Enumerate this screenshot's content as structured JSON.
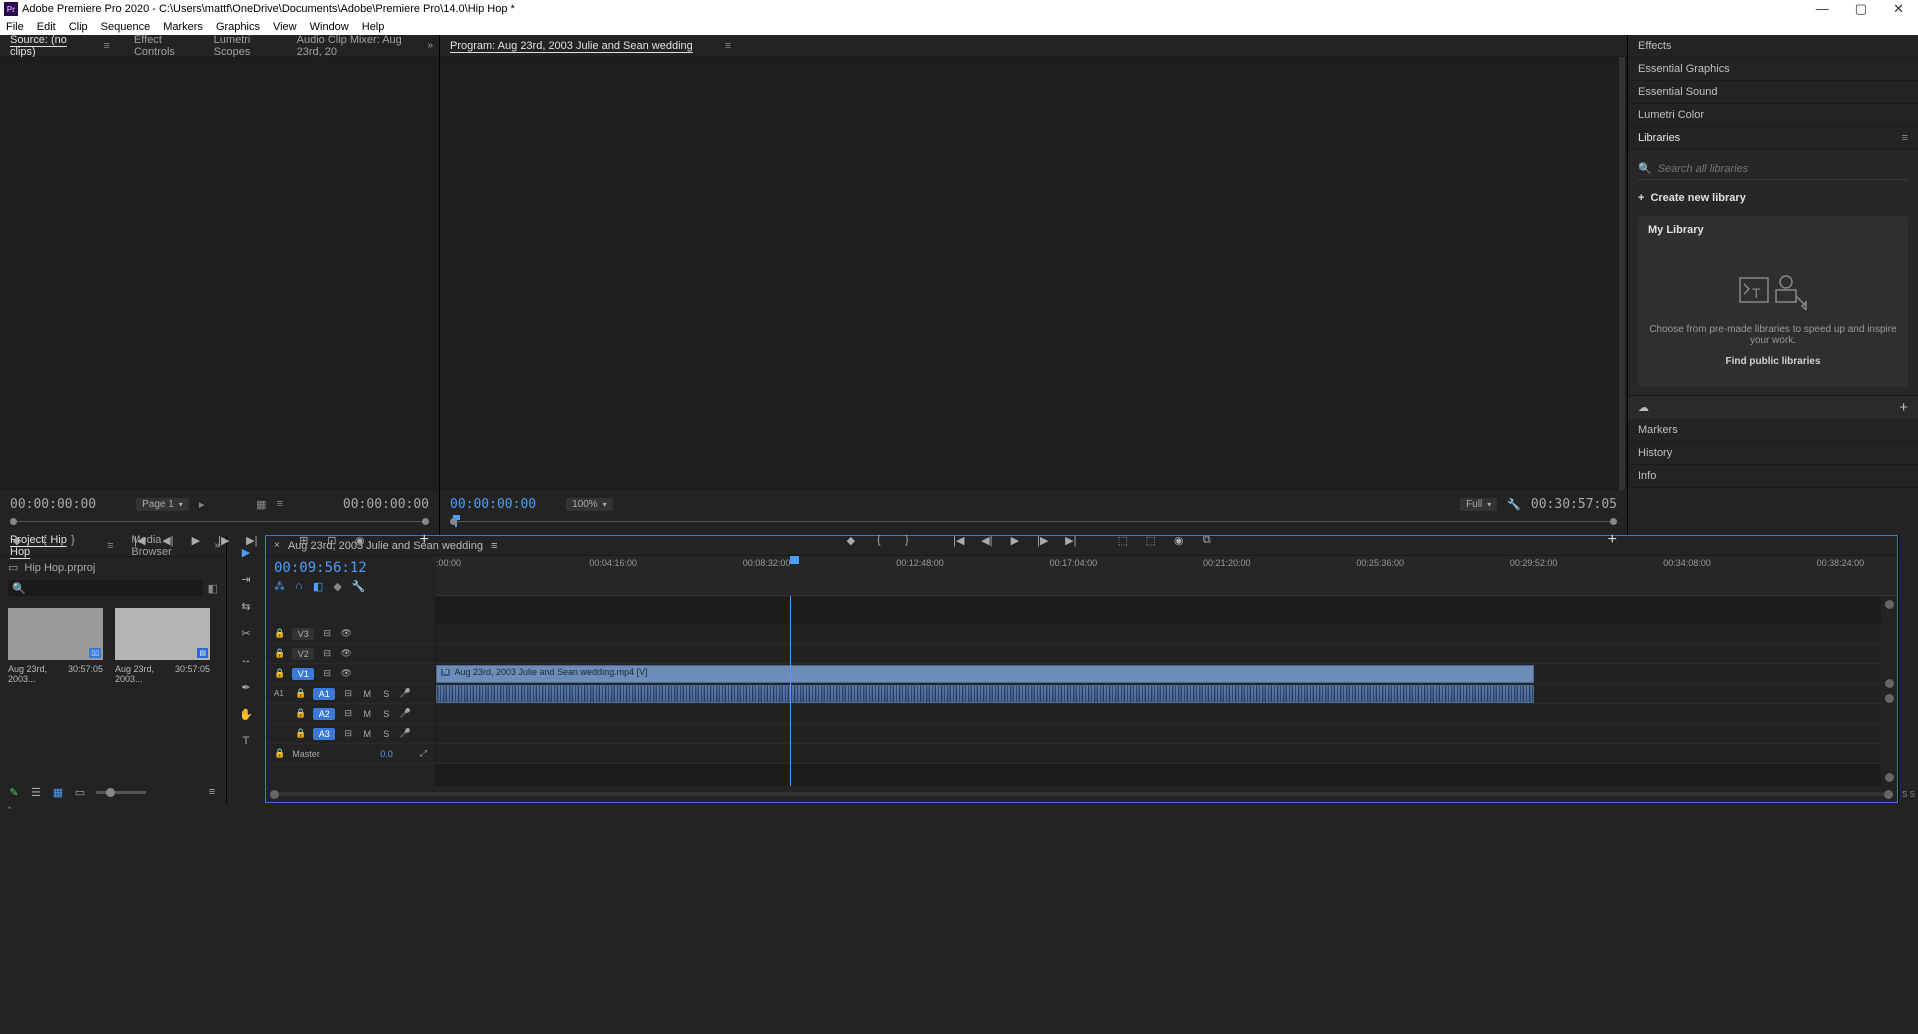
{
  "title": "Adobe Premiere Pro 2020 - C:\\Users\\mattf\\OneDrive\\Documents\\Adobe\\Premiere Pro\\14.0\\Hip Hop *",
  "menu": [
    "File",
    "Edit",
    "Clip",
    "Sequence",
    "Markers",
    "Graphics",
    "View",
    "Window",
    "Help"
  ],
  "source": {
    "tabs": [
      "Source: (no clips)",
      "Effect Controls",
      "Lumetri Scopes",
      "Audio Clip Mixer: Aug 23rd, 20"
    ],
    "tc_left": "00:00:00:00",
    "tc_right": "00:00:00:00",
    "page": "Page 1"
  },
  "program": {
    "tab": "Program: Aug 23rd, 2003 Julie and Sean wedding",
    "tc_left": "00:00:00:00",
    "zoom": "100%",
    "fit": "Full",
    "tc_right": "00:30:57:05"
  },
  "right": {
    "panels": [
      "Effects",
      "Essential Graphics",
      "Essential Sound",
      "Lumetri Color",
      "Libraries"
    ],
    "search_ph": "Search all libraries",
    "create": "Create new library",
    "mylib": "My Library",
    "empty_text": "Choose from pre-made libraries to speed up and inspire your work.",
    "find": "Find public libraries",
    "lower": [
      "Markers",
      "History",
      "Info"
    ]
  },
  "project": {
    "tabs": [
      "Project: Hip Hop",
      "Media Browser"
    ],
    "file": "Hip Hop.prproj",
    "items": [
      {
        "name": "Aug 23rd, 2003...",
        "dur": "30:57:05"
      },
      {
        "name": "Aug 23rd, 2003...",
        "dur": "30:57:05"
      }
    ]
  },
  "timeline": {
    "tab": "Aug 23rd, 2003 Julie and Sean wedding",
    "tc": "00:09:56:12",
    "ticks": [
      ":00:00",
      "00:04:16:00",
      "00:08:32:00",
      "00:12:48:00",
      "00:17:04:00",
      "00:21:20:00",
      "00:25:36:00",
      "00:29:52:00",
      "00:34:08:00",
      "00:38:24:00"
    ],
    "clip_label": "Aug 23rd, 2003 Julie and Sean wedding.mp4 [V]",
    "tracks_v": [
      "V3",
      "V2",
      "V1"
    ],
    "tracks_a": [
      "A1",
      "A2",
      "A3"
    ],
    "master": "Master",
    "master_val": "0.0"
  }
}
